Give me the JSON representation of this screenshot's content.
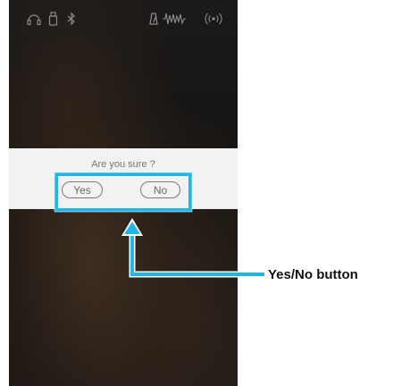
{
  "status_bar": {
    "icons": [
      "headphones-icon",
      "usb-drive-icon",
      "bluetooth-icon",
      "metronome-icon",
      "sound-wave-icon",
      "wireless-signal-icon"
    ]
  },
  "dialog": {
    "title": "Are you sure ?",
    "yes_label": "Yes",
    "no_label": "No"
  },
  "annotation": {
    "label": "Yes/No button",
    "color": "#1fb7e8"
  },
  "colors": {
    "highlight": "#1fb7e8",
    "dialog_bg": "#f2f2f2",
    "screen_bg": "#171615"
  }
}
